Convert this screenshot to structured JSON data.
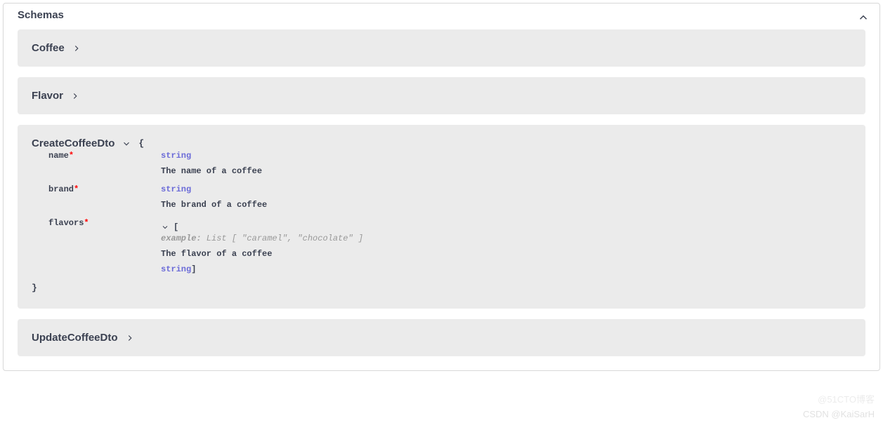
{
  "panel": {
    "title": "Schemas"
  },
  "schemas": [
    {
      "name": "Coffee",
      "expanded": false
    },
    {
      "name": "Flavor",
      "expanded": false
    },
    {
      "name": "CreateCoffeeDto",
      "expanded": true,
      "open_brace": "{",
      "close_brace": "}",
      "properties": [
        {
          "name": "name",
          "required_mark": "*",
          "type": "string",
          "description": "The name of a coffee"
        },
        {
          "name": "brand",
          "required_mark": "*",
          "type": "string",
          "description": "The brand of a coffee"
        },
        {
          "name": "flavors",
          "required_mark": "*",
          "array_open": "[",
          "example_label": "example:",
          "example_value": " List [ \"caramel\", \"chocolate\" ]",
          "description": "The flavor of a coffee",
          "item_type": "string",
          "array_close": "]"
        }
      ]
    },
    {
      "name": "UpdateCoffeeDto",
      "expanded": false
    }
  ],
  "watermark1": "CSDN @KaiSarH",
  "watermark2": "@51CTO博客"
}
